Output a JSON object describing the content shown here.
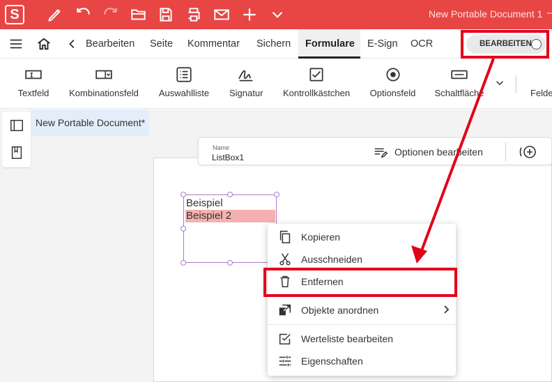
{
  "app": {
    "logo": "S",
    "doc_title": "New Portable Document 1",
    "minimize": "–"
  },
  "titlebar_icons": [
    "pen-icon",
    "undo-icon",
    "redo-icon",
    "open-folder-icon",
    "save-icon",
    "print-icon",
    "mail-icon",
    "plus-icon",
    "chevron-down-icon"
  ],
  "menu": {
    "items": [
      "Bearbeiten",
      "Seite",
      "Kommentar",
      "Sichern",
      "Formulare",
      "E-Sign",
      "OCR"
    ],
    "active": "Formulare",
    "edit_toggle": "BEARBEITEN"
  },
  "ribbon": {
    "buttons": [
      "Textfeld",
      "Kombinationsfeld",
      "Auswahlliste",
      "Signatur",
      "Kontrollkästchen",
      "Optionsfeld",
      "Schaltfläche"
    ],
    "cut_off": "Felde"
  },
  "document": {
    "tab": "New Portable Document*",
    "field_name_label": "Name",
    "field_name_value": "ListBox1",
    "options_button": "Optionen bearbeiten",
    "listbox_items": [
      "Beispiel",
      "Beispiel 2"
    ],
    "listbox_selected": "Beispiel 2"
  },
  "context_menu": {
    "items": [
      "Kopieren",
      "Ausschneiden",
      "Entfernen",
      "Objekte anordnen",
      "Werteliste bearbeiten",
      "Eigenschaften"
    ],
    "highlighted": "Entfernen"
  },
  "colors": {
    "brand_red": "#e84545",
    "highlight_red": "#e3001b",
    "selection": "#f5b0b0",
    "field_border": "#a77cc9"
  }
}
